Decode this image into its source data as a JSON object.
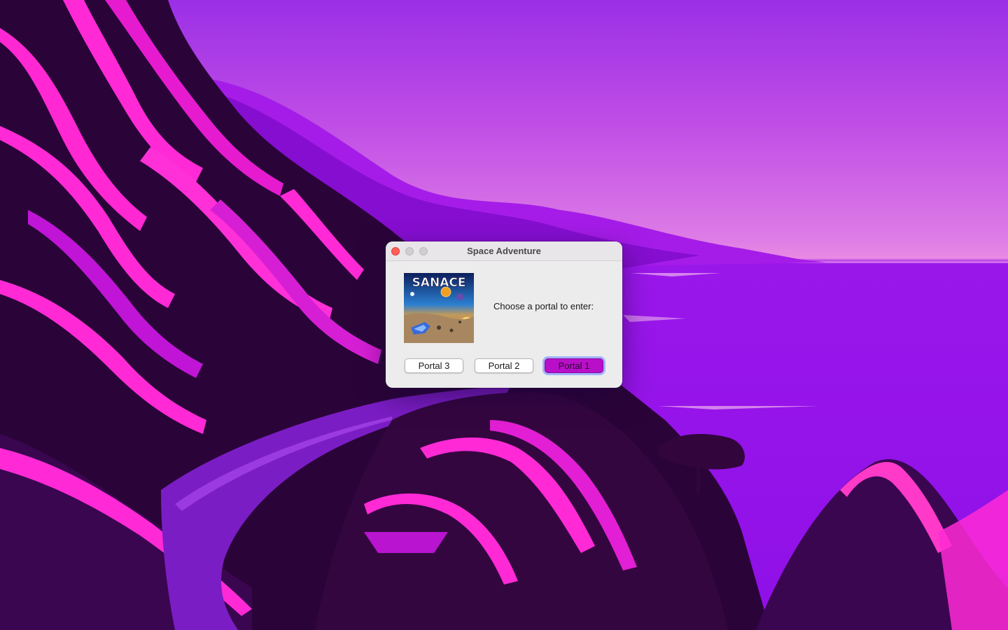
{
  "window": {
    "title": "Space Adventure"
  },
  "dialog": {
    "prompt": "Choose a portal to enter:",
    "image": {
      "logo_text": "SANACE",
      "icon": "space-game-art"
    },
    "buttons": [
      {
        "label": "Portal 3"
      },
      {
        "label": "Portal 2"
      },
      {
        "label": "Portal 1",
        "default": true
      }
    ]
  },
  "colors": {
    "default_button": "#b90fc8",
    "focus_ring": "#94a8ff",
    "close_button": "#fe5f57"
  }
}
